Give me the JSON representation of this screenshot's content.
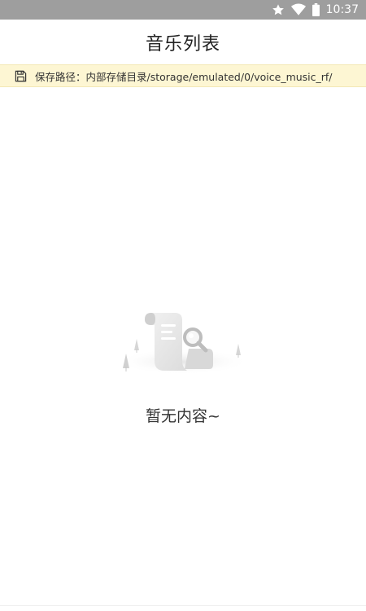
{
  "status_bar": {
    "time": "10:37",
    "icons": [
      "star-icon",
      "wifi-icon",
      "battery-icon"
    ]
  },
  "header": {
    "title": "音乐列表"
  },
  "save_path": {
    "icon": "save-icon",
    "text": "保存路径：内部存储目录/storage/emulated/0/voice_music_rf/"
  },
  "empty_state": {
    "icon": "document-search-illustration",
    "text": "暂无内容~"
  },
  "colors": {
    "status_bar_bg": "#9e9e9e",
    "banner_bg": "#fdf6d3",
    "title_text": "#222222"
  }
}
